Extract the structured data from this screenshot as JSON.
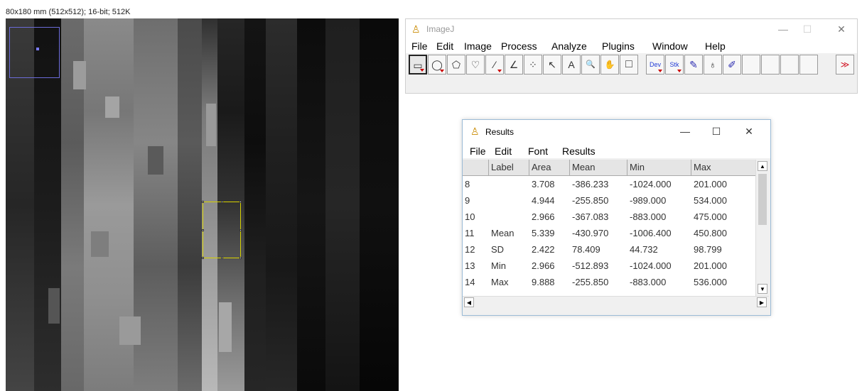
{
  "image_window": {
    "info": "80x180 mm (512x512); 16-bit; 512K"
  },
  "imagej_window": {
    "title": "ImageJ",
    "window_controls": [
      "—",
      "☐",
      "✕"
    ],
    "menus": [
      "File",
      "Edit",
      "Image",
      "Process",
      "Analyze",
      "Plugins",
      "Window",
      "Help"
    ],
    "tools": [
      {
        "name": "rectangle-tool",
        "glyph": "▭"
      },
      {
        "name": "oval-tool",
        "glyph": "◯"
      },
      {
        "name": "polygon-tool",
        "glyph": "⬠"
      },
      {
        "name": "freehand-tool",
        "glyph": "♡"
      },
      {
        "name": "line-tool",
        "glyph": "⁄"
      },
      {
        "name": "angle-tool",
        "glyph": "∠"
      },
      {
        "name": "point-tool",
        "glyph": "⁘"
      },
      {
        "name": "wand-tool",
        "glyph": "↖"
      },
      {
        "name": "text-tool",
        "glyph": "A"
      },
      {
        "name": "magnifier-tool",
        "glyph": "🔍"
      },
      {
        "name": "hand-tool",
        "glyph": "✋"
      },
      {
        "name": "color-picker-tool",
        "glyph": "□"
      },
      {
        "name": "dev-tool",
        "glyph": "Dev"
      },
      {
        "name": "stk-tool",
        "glyph": "Stk"
      },
      {
        "name": "brush-tool",
        "glyph": "✎"
      },
      {
        "name": "fill-tool",
        "glyph": "♁"
      },
      {
        "name": "pencil-tool",
        "glyph": "✐"
      },
      {
        "name": "more-tools",
        "glyph": "≫"
      }
    ]
  },
  "results_window": {
    "title": "Results",
    "window_controls": [
      "—",
      "☐",
      "✕"
    ],
    "menus": [
      "File",
      "Edit",
      "Font",
      "Results"
    ],
    "columns": [
      "",
      "Label",
      "Area",
      "Mean",
      "Min",
      "Max"
    ],
    "rows": [
      [
        "8",
        "",
        "3.708",
        "-386.233",
        "-1024.000",
        "201.000"
      ],
      [
        "9",
        "",
        "4.944",
        "-255.850",
        "-989.000",
        "534.000"
      ],
      [
        "10",
        "",
        "2.966",
        "-367.083",
        "-883.000",
        "475.000"
      ],
      [
        "11",
        "Mean",
        "5.339",
        "-430.970",
        "-1006.400",
        "450.800"
      ],
      [
        "12",
        "SD",
        "2.422",
        "78.409",
        "44.732",
        "98.799"
      ],
      [
        "13",
        "Min",
        "2.966",
        "-512.893",
        "-1024.000",
        "201.000"
      ],
      [
        "14",
        "Max",
        "9.888",
        "-255.850",
        "-883.000",
        "536.000"
      ]
    ]
  },
  "colors": {
    "roi": "#d8d200",
    "navigator": "#6b6bd8",
    "more_arrows": "#d01020"
  }
}
